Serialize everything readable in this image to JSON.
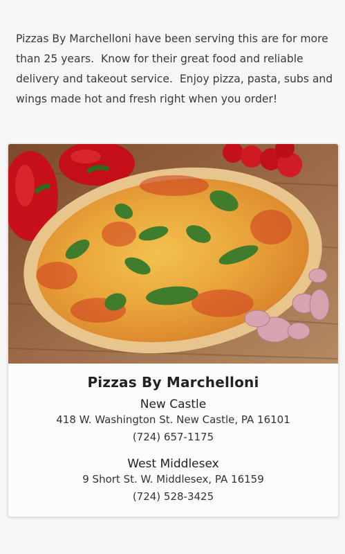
{
  "intro": {
    "text": "Pizzas By Marchelloni have been serving this are for more than 25 years.  Know for their great food and reliable delivery and takeout service.  Enjoy pizza, pasta, subs and wings made hot and fresh right when you order!"
  },
  "card": {
    "title": "Pizzas By Marchelloni",
    "locations": [
      {
        "name": "New Castle",
        "address": "418 W. Washington St. New Castle, PA 16101",
        "phone": "(724) 657-1175"
      },
      {
        "name": "West Middlesex",
        "address": "9 Short St. W. Middlesex, PA 16159",
        "phone": "(724) 528-3425"
      }
    ]
  }
}
